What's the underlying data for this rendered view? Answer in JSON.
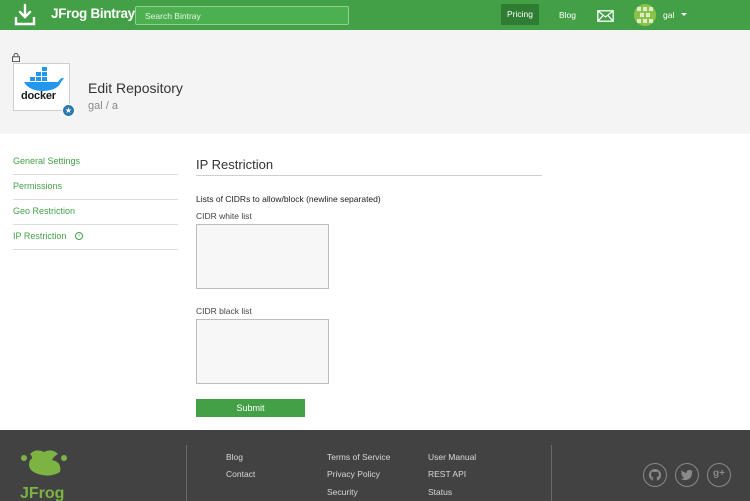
{
  "header": {
    "brand": "JFrog Bintray",
    "search_placeholder": "Search Bintray",
    "nav_pricing": "Pricing",
    "nav_blog": "Blog",
    "username": "gal"
  },
  "repo": {
    "type_label": "docker",
    "title": "Edit Repository",
    "breadcrumb": "gal / a"
  },
  "sidebar": {
    "items": [
      {
        "label": "General Settings"
      },
      {
        "label": "Permissions"
      },
      {
        "label": "Geo Restriction"
      },
      {
        "label": "IP Restriction",
        "active": true
      }
    ]
  },
  "main": {
    "section_title": "IP Restriction",
    "description": "Lists of CIDRs to allow/block (newline separated)",
    "white_label": "CIDR white list",
    "black_label": "CIDR black list",
    "white_value": "",
    "black_value": "",
    "submit_label": "Submit"
  },
  "footer": {
    "col1": [
      "Blog",
      "Contact"
    ],
    "col2": [
      "Terms of Service",
      "Privacy Policy",
      "Security"
    ],
    "col3": [
      "User Manual",
      "REST API",
      "Status"
    ],
    "logo_text": "JFrog",
    "social_icons": [
      "github-icon",
      "twitter-icon",
      "google-plus-icon"
    ]
  },
  "colors": {
    "accent": "#43a047",
    "footer_bg": "#424242",
    "badge": "#2c79b0"
  }
}
